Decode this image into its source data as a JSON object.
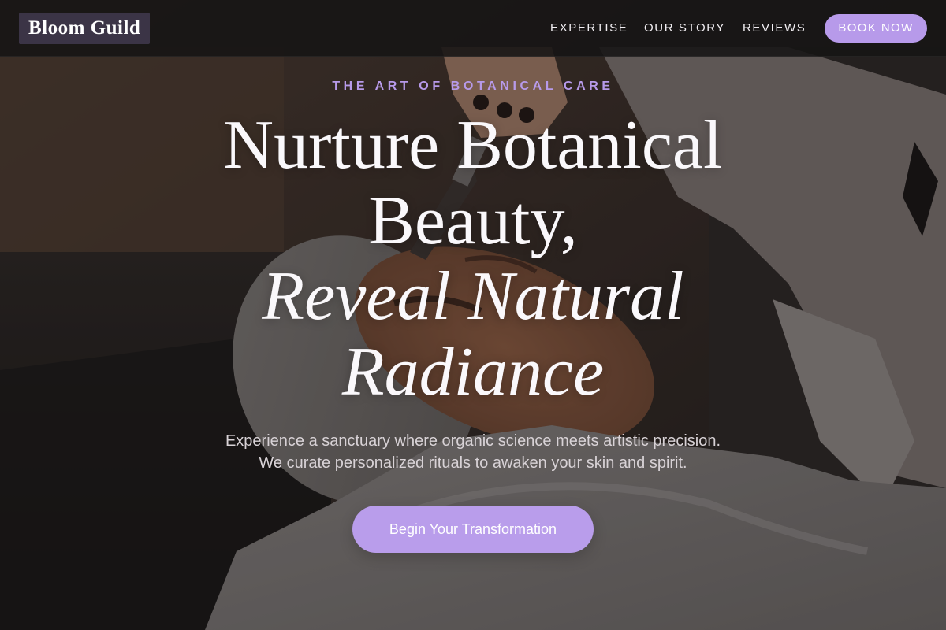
{
  "header": {
    "logo": "Bloom Guild",
    "nav": {
      "expertise": "EXPERTISE",
      "our_story": "OUR STORY",
      "reviews": "REVIEWS"
    },
    "book_now": "BOOK NOW"
  },
  "hero": {
    "eyebrow": "THE ART OF BOTANICAL CARE",
    "headline": {
      "line1": "Nurture Botanical",
      "line2": "Beauty,",
      "line3": "Reveal Natural",
      "line4": "Radiance"
    },
    "subtext": {
      "line1": "Experience a sanctuary where organic science meets artistic precision.",
      "line2": "We curate personalized rituals to awaken your skin and spirit."
    },
    "cta": "Begin Your Transformation",
    "background_image": "woman-receiving-facial-treatment-photo"
  },
  "colors": {
    "accent": "#b79aea",
    "header_bg": "#161515",
    "logo_bg": "#3b3446",
    "headline_text": "#faf8fb",
    "subtext": "#d8d2d6"
  }
}
